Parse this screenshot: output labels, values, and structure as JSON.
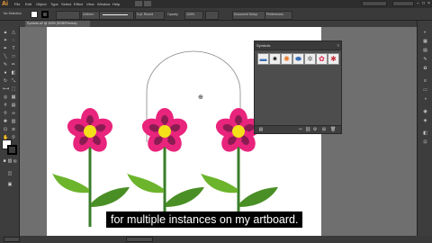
{
  "app": {
    "logo": "Ai"
  },
  "menus": [
    "File",
    "Edit",
    "Object",
    "Type",
    "Select",
    "Effect",
    "View",
    "Window",
    "Help"
  ],
  "options_bar": {
    "selection": "No Selection",
    "stroke_style": "Uniform",
    "brush": "5 pt. Round",
    "opacity_label": "Opacity",
    "opacity": "100%",
    "document_setup": "Document Setup",
    "preferences": "Preferences"
  },
  "document_tab": {
    "label": "Symbols.ai* @ 100% (RGB/Preview)"
  },
  "symbols_panel": {
    "title": "Symbols",
    "menu_glyph": "≡",
    "symbols": [
      {
        "name": "banner",
        "glyph": "▬",
        "color": "#3a6fb5"
      },
      {
        "name": "splat",
        "glyph": "✷",
        "color": "#111111"
      },
      {
        "name": "burst",
        "glyph": "✺",
        "color": "#e87522"
      },
      {
        "name": "ribbon",
        "glyph": "⬬",
        "color": "#3a6fb5"
      },
      {
        "name": "gear",
        "glyph": "✲",
        "color": "#666666"
      },
      {
        "name": "flower",
        "glyph": "✿",
        "color": "#d8254a"
      },
      {
        "name": "badge",
        "glyph": "✱",
        "color": "#c6303c"
      }
    ]
  },
  "subtitle": "for multiple instances on my artboard.",
  "colors": {
    "petal": "#e8247c",
    "petal_dark": "#8a1c52",
    "center": "#f4e11a",
    "stem": "#3a7d2a",
    "leaf": "#6cb42c",
    "leaf_dark": "#4a8f25",
    "accent": "#f3a13a"
  }
}
